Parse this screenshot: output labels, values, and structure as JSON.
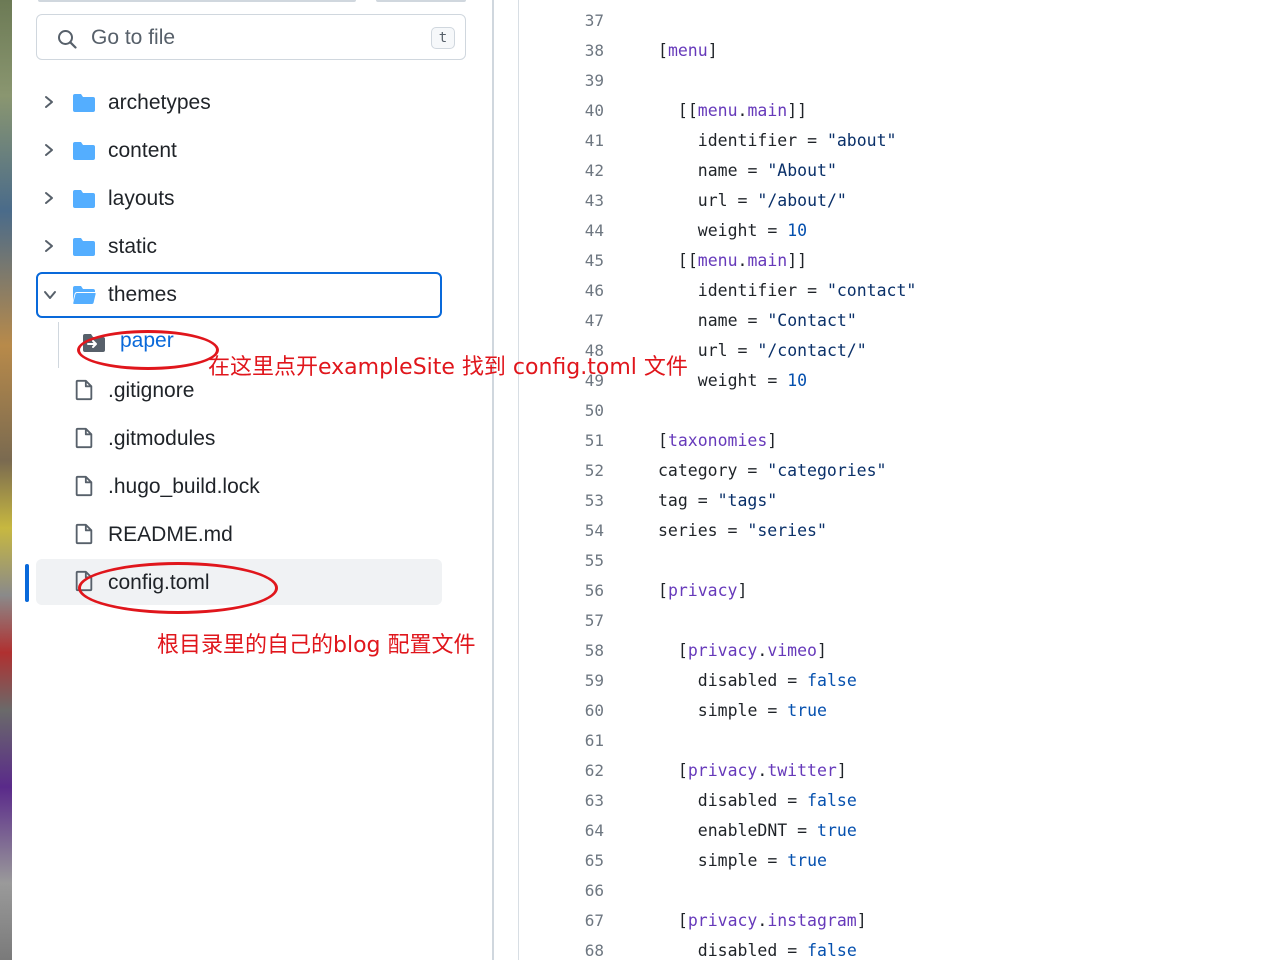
{
  "search": {
    "placeholder": "Go to file",
    "shortcut": "t"
  },
  "tree": {
    "items": [
      {
        "label": "archetypes",
        "type": "folder",
        "expanded": false
      },
      {
        "label": "content",
        "type": "folder",
        "expanded": false
      },
      {
        "label": "layouts",
        "type": "folder",
        "expanded": false
      },
      {
        "label": "static",
        "type": "folder",
        "expanded": false
      },
      {
        "label": "themes",
        "type": "folder",
        "expanded": true
      },
      {
        "label": "paper",
        "type": "submodule"
      },
      {
        "label": ".gitignore",
        "type": "file"
      },
      {
        "label": ".gitmodules",
        "type": "file"
      },
      {
        "label": ".hugo_build.lock",
        "type": "file"
      },
      {
        "label": "README.md",
        "type": "file"
      },
      {
        "label": "config.toml",
        "type": "file",
        "active": true
      }
    ]
  },
  "annotations": {
    "paper_note": "在这里点开exampleSite 找到 config.toml 文件",
    "config_note": "根目录里的自己的blog 配置文件"
  },
  "colors": {
    "accent": "#0969da",
    "annotation": "#e0161c",
    "folder": "#54aeff"
  },
  "code": {
    "lines": [
      {
        "n": "37",
        "indent": 0,
        "tokens": []
      },
      {
        "n": "38",
        "indent": 0,
        "tokens": [
          [
            "br",
            "["
          ],
          [
            "sec",
            "menu"
          ],
          [
            "br",
            "]"
          ]
        ]
      },
      {
        "n": "39",
        "indent": 0,
        "tokens": []
      },
      {
        "n": "40",
        "indent": 2,
        "tokens": [
          [
            "br",
            "[["
          ],
          [
            "sec",
            "menu"
          ],
          [
            "br",
            "."
          ],
          [
            "sec",
            "main"
          ],
          [
            "br",
            "]]"
          ]
        ]
      },
      {
        "n": "41",
        "indent": 4,
        "tokens": [
          [
            "key",
            "identifier = "
          ],
          [
            "str",
            "\"about\""
          ]
        ]
      },
      {
        "n": "42",
        "indent": 4,
        "tokens": [
          [
            "key",
            "name = "
          ],
          [
            "str",
            "\"About\""
          ]
        ]
      },
      {
        "n": "43",
        "indent": 4,
        "tokens": [
          [
            "key",
            "url = "
          ],
          [
            "str",
            "\"/about/\""
          ]
        ]
      },
      {
        "n": "44",
        "indent": 4,
        "tokens": [
          [
            "key",
            "weight = "
          ],
          [
            "num",
            "10"
          ]
        ]
      },
      {
        "n": "45",
        "indent": 2,
        "tokens": [
          [
            "br",
            "[["
          ],
          [
            "sec",
            "menu"
          ],
          [
            "br",
            "."
          ],
          [
            "sec",
            "main"
          ],
          [
            "br",
            "]]"
          ]
        ]
      },
      {
        "n": "46",
        "indent": 4,
        "tokens": [
          [
            "key",
            "identifier = "
          ],
          [
            "str",
            "\"contact\""
          ]
        ]
      },
      {
        "n": "47",
        "indent": 4,
        "tokens": [
          [
            "key",
            "name = "
          ],
          [
            "str",
            "\"Contact\""
          ]
        ]
      },
      {
        "n": "48",
        "indent": 4,
        "tokens": [
          [
            "key",
            "url = "
          ],
          [
            "str",
            "\"/contact/\""
          ]
        ]
      },
      {
        "n": "49",
        "indent": 4,
        "tokens": [
          [
            "key",
            "weight = "
          ],
          [
            "num",
            "10"
          ]
        ]
      },
      {
        "n": "50",
        "indent": 0,
        "tokens": []
      },
      {
        "n": "51",
        "indent": 0,
        "tokens": [
          [
            "br",
            "["
          ],
          [
            "sec",
            "taxonomies"
          ],
          [
            "br",
            "]"
          ]
        ]
      },
      {
        "n": "52",
        "indent": 0,
        "tokens": [
          [
            "key",
            "category = "
          ],
          [
            "str",
            "\"categories\""
          ]
        ]
      },
      {
        "n": "53",
        "indent": 0,
        "tokens": [
          [
            "key",
            "tag = "
          ],
          [
            "str",
            "\"tags\""
          ]
        ]
      },
      {
        "n": "54",
        "indent": 0,
        "tokens": [
          [
            "key",
            "series = "
          ],
          [
            "str",
            "\"series\""
          ]
        ]
      },
      {
        "n": "55",
        "indent": 0,
        "tokens": []
      },
      {
        "n": "56",
        "indent": 0,
        "tokens": [
          [
            "br",
            "["
          ],
          [
            "sec",
            "privacy"
          ],
          [
            "br",
            "]"
          ]
        ]
      },
      {
        "n": "57",
        "indent": 0,
        "tokens": []
      },
      {
        "n": "58",
        "indent": 2,
        "tokens": [
          [
            "br",
            "["
          ],
          [
            "sec",
            "privacy"
          ],
          [
            "br",
            "."
          ],
          [
            "sec",
            "vimeo"
          ],
          [
            "br",
            "]"
          ]
        ]
      },
      {
        "n": "59",
        "indent": 4,
        "tokens": [
          [
            "key",
            "disabled = "
          ],
          [
            "bool",
            "false"
          ]
        ]
      },
      {
        "n": "60",
        "indent": 4,
        "tokens": [
          [
            "key",
            "simple = "
          ],
          [
            "bool",
            "true"
          ]
        ]
      },
      {
        "n": "61",
        "indent": 0,
        "tokens": []
      },
      {
        "n": "62",
        "indent": 2,
        "tokens": [
          [
            "br",
            "["
          ],
          [
            "sec",
            "privacy"
          ],
          [
            "br",
            "."
          ],
          [
            "sec",
            "twitter"
          ],
          [
            "br",
            "]"
          ]
        ]
      },
      {
        "n": "63",
        "indent": 4,
        "tokens": [
          [
            "key",
            "disabled = "
          ],
          [
            "bool",
            "false"
          ]
        ]
      },
      {
        "n": "64",
        "indent": 4,
        "tokens": [
          [
            "key",
            "enableDNT = "
          ],
          [
            "bool",
            "true"
          ]
        ]
      },
      {
        "n": "65",
        "indent": 4,
        "tokens": [
          [
            "key",
            "simple = "
          ],
          [
            "bool",
            "true"
          ]
        ]
      },
      {
        "n": "66",
        "indent": 0,
        "tokens": []
      },
      {
        "n": "67",
        "indent": 2,
        "tokens": [
          [
            "br",
            "["
          ],
          [
            "sec",
            "privacy"
          ],
          [
            "br",
            "."
          ],
          [
            "sec",
            "instagram"
          ],
          [
            "br",
            "]"
          ]
        ]
      },
      {
        "n": "68",
        "indent": 4,
        "tokens": [
          [
            "key",
            "disabled = "
          ],
          [
            "bool",
            "false"
          ]
        ]
      }
    ]
  }
}
